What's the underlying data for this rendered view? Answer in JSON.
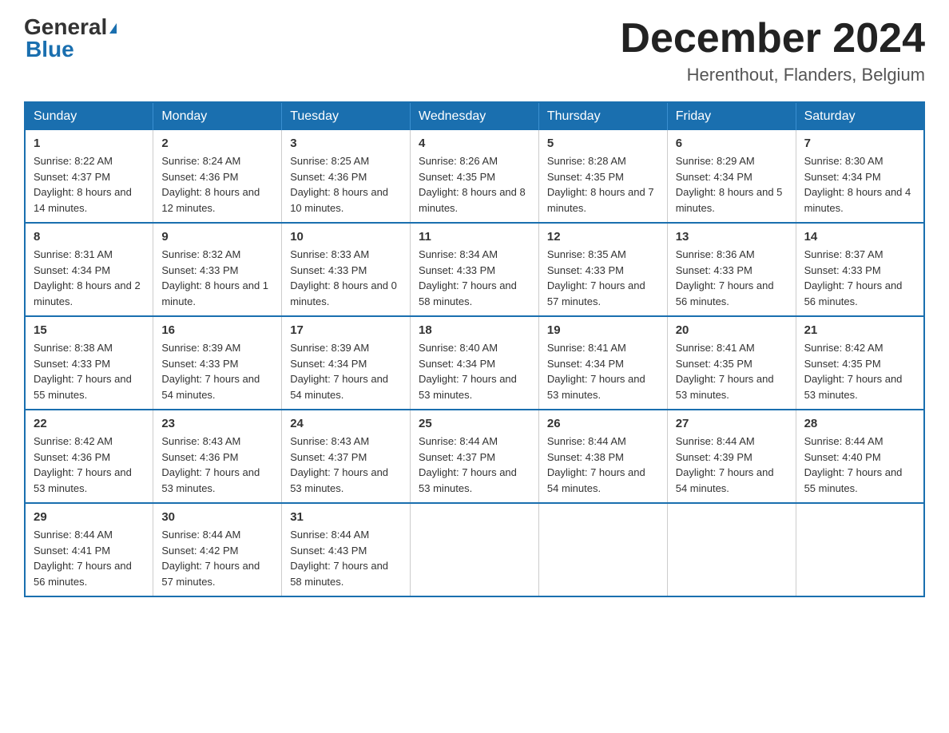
{
  "logo": {
    "line1": "General",
    "triangle": "▶",
    "line2": "Blue"
  },
  "title": "December 2024",
  "location": "Herenthout, Flanders, Belgium",
  "days_of_week": [
    "Sunday",
    "Monday",
    "Tuesday",
    "Wednesday",
    "Thursday",
    "Friday",
    "Saturday"
  ],
  "weeks": [
    [
      {
        "day": "1",
        "sunrise": "8:22 AM",
        "sunset": "4:37 PM",
        "daylight": "8 hours and 14 minutes."
      },
      {
        "day": "2",
        "sunrise": "8:24 AM",
        "sunset": "4:36 PM",
        "daylight": "8 hours and 12 minutes."
      },
      {
        "day": "3",
        "sunrise": "8:25 AM",
        "sunset": "4:36 PM",
        "daylight": "8 hours and 10 minutes."
      },
      {
        "day": "4",
        "sunrise": "8:26 AM",
        "sunset": "4:35 PM",
        "daylight": "8 hours and 8 minutes."
      },
      {
        "day": "5",
        "sunrise": "8:28 AM",
        "sunset": "4:35 PM",
        "daylight": "8 hours and 7 minutes."
      },
      {
        "day": "6",
        "sunrise": "8:29 AM",
        "sunset": "4:34 PM",
        "daylight": "8 hours and 5 minutes."
      },
      {
        "day": "7",
        "sunrise": "8:30 AM",
        "sunset": "4:34 PM",
        "daylight": "8 hours and 4 minutes."
      }
    ],
    [
      {
        "day": "8",
        "sunrise": "8:31 AM",
        "sunset": "4:34 PM",
        "daylight": "8 hours and 2 minutes."
      },
      {
        "day": "9",
        "sunrise": "8:32 AM",
        "sunset": "4:33 PM",
        "daylight": "8 hours and 1 minute."
      },
      {
        "day": "10",
        "sunrise": "8:33 AM",
        "sunset": "4:33 PM",
        "daylight": "8 hours and 0 minutes."
      },
      {
        "day": "11",
        "sunrise": "8:34 AM",
        "sunset": "4:33 PM",
        "daylight": "7 hours and 58 minutes."
      },
      {
        "day": "12",
        "sunrise": "8:35 AM",
        "sunset": "4:33 PM",
        "daylight": "7 hours and 57 minutes."
      },
      {
        "day": "13",
        "sunrise": "8:36 AM",
        "sunset": "4:33 PM",
        "daylight": "7 hours and 56 minutes."
      },
      {
        "day": "14",
        "sunrise": "8:37 AM",
        "sunset": "4:33 PM",
        "daylight": "7 hours and 56 minutes."
      }
    ],
    [
      {
        "day": "15",
        "sunrise": "8:38 AM",
        "sunset": "4:33 PM",
        "daylight": "7 hours and 55 minutes."
      },
      {
        "day": "16",
        "sunrise": "8:39 AM",
        "sunset": "4:33 PM",
        "daylight": "7 hours and 54 minutes."
      },
      {
        "day": "17",
        "sunrise": "8:39 AM",
        "sunset": "4:34 PM",
        "daylight": "7 hours and 54 minutes."
      },
      {
        "day": "18",
        "sunrise": "8:40 AM",
        "sunset": "4:34 PM",
        "daylight": "7 hours and 53 minutes."
      },
      {
        "day": "19",
        "sunrise": "8:41 AM",
        "sunset": "4:34 PM",
        "daylight": "7 hours and 53 minutes."
      },
      {
        "day": "20",
        "sunrise": "8:41 AM",
        "sunset": "4:35 PM",
        "daylight": "7 hours and 53 minutes."
      },
      {
        "day": "21",
        "sunrise": "8:42 AM",
        "sunset": "4:35 PM",
        "daylight": "7 hours and 53 minutes."
      }
    ],
    [
      {
        "day": "22",
        "sunrise": "8:42 AM",
        "sunset": "4:36 PM",
        "daylight": "7 hours and 53 minutes."
      },
      {
        "day": "23",
        "sunrise": "8:43 AM",
        "sunset": "4:36 PM",
        "daylight": "7 hours and 53 minutes."
      },
      {
        "day": "24",
        "sunrise": "8:43 AM",
        "sunset": "4:37 PM",
        "daylight": "7 hours and 53 minutes."
      },
      {
        "day": "25",
        "sunrise": "8:44 AM",
        "sunset": "4:37 PM",
        "daylight": "7 hours and 53 minutes."
      },
      {
        "day": "26",
        "sunrise": "8:44 AM",
        "sunset": "4:38 PM",
        "daylight": "7 hours and 54 minutes."
      },
      {
        "day": "27",
        "sunrise": "8:44 AM",
        "sunset": "4:39 PM",
        "daylight": "7 hours and 54 minutes."
      },
      {
        "day": "28",
        "sunrise": "8:44 AM",
        "sunset": "4:40 PM",
        "daylight": "7 hours and 55 minutes."
      }
    ],
    [
      {
        "day": "29",
        "sunrise": "8:44 AM",
        "sunset": "4:41 PM",
        "daylight": "7 hours and 56 minutes."
      },
      {
        "day": "30",
        "sunrise": "8:44 AM",
        "sunset": "4:42 PM",
        "daylight": "7 hours and 57 minutes."
      },
      {
        "day": "31",
        "sunrise": "8:44 AM",
        "sunset": "4:43 PM",
        "daylight": "7 hours and 58 minutes."
      },
      null,
      null,
      null,
      null
    ]
  ]
}
